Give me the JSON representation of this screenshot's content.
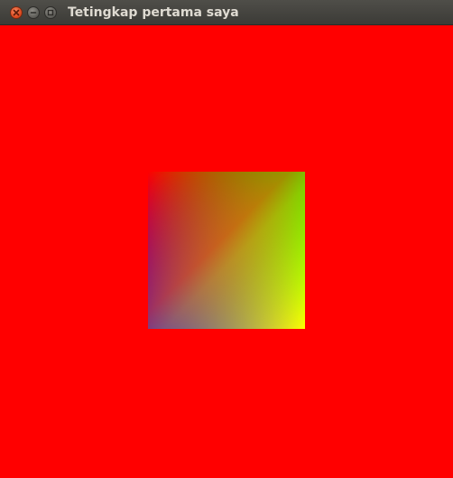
{
  "window": {
    "title": "Tetingkap pertama saya"
  },
  "titlebar_buttons": {
    "close_icon": "close-icon",
    "minimize_icon": "minimize-icon",
    "maximize_icon": "maximize-icon"
  },
  "canvas": {
    "background_color": "#ff0000",
    "square_corner_colors": {
      "top_left": "#ff0000",
      "top_right": "#00ff00",
      "bottom_right": "#ffff00",
      "bottom_left": "#0000ff"
    }
  }
}
